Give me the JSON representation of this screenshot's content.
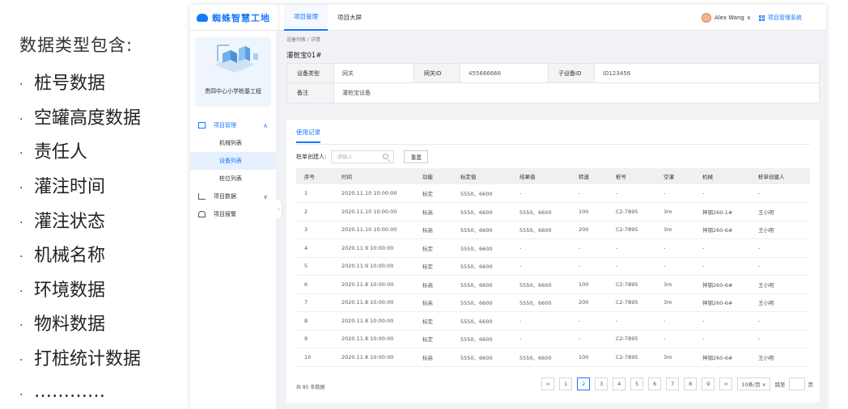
{
  "slide": {
    "title": "数据类型包含:",
    "bullet": ".",
    "items": [
      "桩号数据",
      "空罐高度数据",
      "责任人",
      "灌注时间",
      "灌注状态",
      "机械名称",
      "环境数据",
      "物料数据",
      "打桩统计数据",
      "…………"
    ]
  },
  "header": {
    "brand": "蜘蛛智慧工地",
    "tabs": [
      "项目管理",
      "项目大屏"
    ],
    "user": "Alex Wang",
    "user_chevron": "∨",
    "system_link": "项目管理系统"
  },
  "sidebar": {
    "project_name": "贵四中心小学桩基工程",
    "menu": [
      {
        "label": "项目管理",
        "chevron": "∧"
      },
      {
        "label": "项目数据",
        "chevron": "∨"
      },
      {
        "label": "项目报警",
        "chevron": ""
      }
    ],
    "submenu": [
      "机械列表",
      "设备列表",
      "桩位列表"
    ],
    "collapse": "‹"
  },
  "main": {
    "breadcrumb": "设备列表 / 详情",
    "title": "灌桩宝01#",
    "info": {
      "device_type_label": "设备类型",
      "device_type": "网关",
      "gateway_id_label": "网关ID",
      "gateway_id": "455666666",
      "sub_device_id_label": "子设备ID",
      "sub_device_id": "ID123456",
      "note_label": "备注",
      "note": "灌桩宝设备"
    },
    "tab": "使用记录",
    "filter_label": "桩单创建人:",
    "filter_placeholder": "请输入",
    "reset_label": "重置",
    "table": {
      "headers": [
        "序号",
        "时间",
        "功能",
        "标定值",
        "结果值",
        "转速",
        "桩号",
        "空灌",
        "机械",
        "桩单创建人"
      ],
      "rows": [
        [
          "1",
          "2020.11.10 10:00:00",
          "标定",
          "5550、6600",
          "-",
          "-",
          "-",
          "-",
          "-",
          "-"
        ],
        [
          "2",
          "2020.11.10 10:00:00",
          "标高",
          "5550、6600",
          "5550、6600",
          "100",
          "C2-7895",
          "3m",
          "神钢260-1#",
          "王小明"
        ],
        [
          "3",
          "2020.11.10 10:00:00",
          "标高",
          "5550、6600",
          "5550、6600",
          "200",
          "C2-7895",
          "3m",
          "神钢260-6#",
          "王小明"
        ],
        [
          "4",
          "2020.11.9 10:00:00",
          "标定",
          "5550、6600",
          "-",
          "-",
          "-",
          "-",
          "-",
          "-"
        ],
        [
          "5",
          "2020.11.9 10:00:00",
          "标定",
          "5550、6600",
          "-",
          "-",
          "-",
          "-",
          "-",
          "-"
        ],
        [
          "6",
          "2020.11.8 10:00:00",
          "标高",
          "5550、6600",
          "5550、6600",
          "100",
          "C2-7895",
          "3m",
          "神钢260-6#",
          "王小明"
        ],
        [
          "7",
          "2020.11.8 10:00:00",
          "标高",
          "5550、6600",
          "5550、6600",
          "200",
          "C2-7895",
          "3m",
          "神钢260-6#",
          "王小明"
        ],
        [
          "8",
          "2020.11.8 10:00:00",
          "标定",
          "5550、6600",
          "-",
          "-",
          "-",
          "-",
          "-",
          "-"
        ],
        [
          "9",
          "2020.11.8 10:00:00",
          "标定",
          "5550、6600",
          "-",
          "-",
          "C2-7895",
          "-",
          "-",
          "-"
        ],
        [
          "10",
          "2020.11.8 10:00:00",
          "标高",
          "5550、6600",
          "5550、6600",
          "100",
          "C2-7895",
          "3m",
          "神钢260-6#",
          "王小明"
        ]
      ]
    },
    "footer": {
      "total": "共 85 条数据",
      "prev": "<",
      "next": ">",
      "pages": [
        "1",
        "2",
        "3",
        "4",
        "5",
        "6",
        "7",
        "8",
        "9"
      ],
      "current_page": "2",
      "page_size": "10条/页 ∨",
      "jump_label": "跳至",
      "page_suffix": "页"
    }
  },
  "colors": {
    "accent": "#1677ff",
    "header_bg": "#eef0f4"
  }
}
